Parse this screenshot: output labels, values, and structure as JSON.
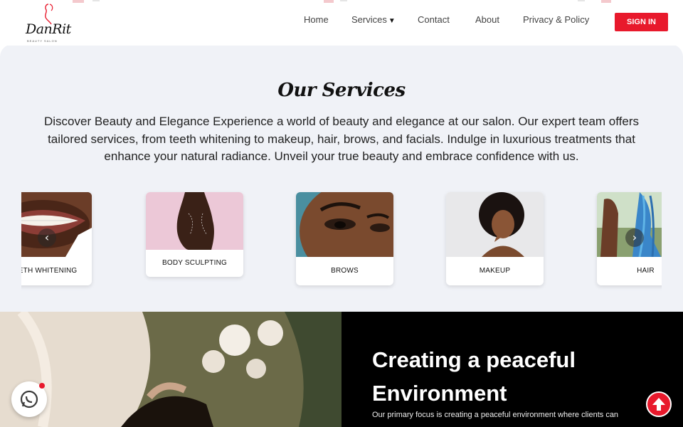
{
  "brand": {
    "logo_text": "DanRit",
    "logo_sub": "BEAUTY SALON",
    "accent": "#e8192c"
  },
  "nav": {
    "home": "Home",
    "services": "Services",
    "contact": "Contact",
    "about": "About",
    "privacy": "Privacy & Policy",
    "signin": "SIGN IN"
  },
  "services": {
    "title": "Our Services",
    "description": "Discover Beauty and Elegance Experience a world of beauty and elegance at our salon. Our expert team offers tailored services, from teeth whitening to makeup, hair, brows, and facials. Indulge in luxurious treatments that enhance your natural radiance. Unveil your true beauty and embrace confidence with us.",
    "cards": [
      {
        "label": "TEETH WHITENING"
      },
      {
        "label": "BODY SCULPTING"
      },
      {
        "label": "BROWS"
      },
      {
        "label": "MAKEUP"
      },
      {
        "label": "HAIR"
      }
    ]
  },
  "peace": {
    "title_line1": "Creating a peaceful",
    "title_line2": "Environment",
    "text": "Our primary focus is creating a peaceful environment where clients can"
  },
  "icons": {
    "prev": "chevron-left-icon",
    "next": "chevron-right-icon",
    "whatsapp": "whatsapp-icon",
    "scroll_top": "arrow-up-icon"
  }
}
